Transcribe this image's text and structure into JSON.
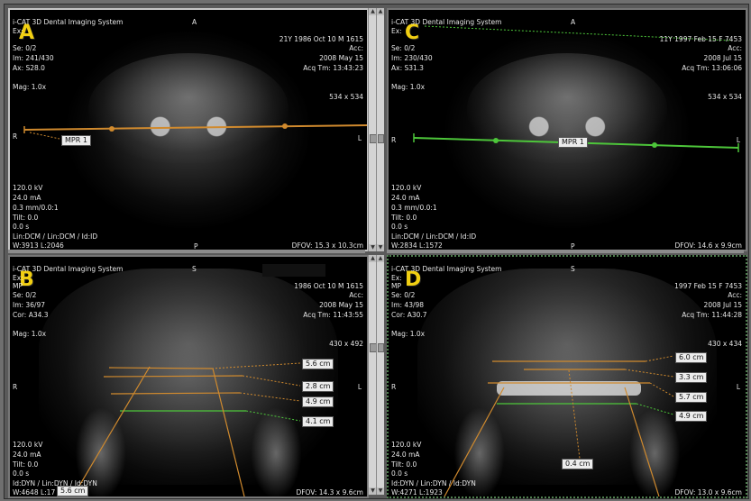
{
  "colors": {
    "orange": "#d08a2e",
    "green": "#4dc63a",
    "label_yellow": "#f1cf12"
  },
  "panels": {
    "A": {
      "letter": "A",
      "title": "i-CAT 3D Dental Imaging System",
      "orient_top": "A",
      "orient_bottom": "P",
      "orient_left": "R",
      "orient_right": "L",
      "ex": "Ex:",
      "se": "Se: 0/2",
      "im": "Im: 241/430",
      "ax": "Ax: S28.0",
      "mag": "Mag: 1.0x",
      "patient": "21Y 1986 Oct 10 M 1615",
      "acc": "Acc:",
      "date": "2008 May 15",
      "acq": "Acq Tm: 13:43:23",
      "matrix": "534 x 534",
      "kv": "120.0 kV",
      "ma": "24.0 mA",
      "mm": "0.3 mm/0.0:1",
      "tilt": "Tilt: 0.0",
      "time": "0.0 s",
      "lin": "Lin:DCM / Lin:DCM / Id:ID",
      "wl": "W:3913 L:2046",
      "dfov": "DFOV: 15.3 x 10.3cm",
      "mpr_label": "MPR 1"
    },
    "B": {
      "letter": "B",
      "title": "i-CAT 3D Dental Imaging System",
      "orient_top": "S",
      "orient_left": "R",
      "orient_right": "L",
      "ex": "Ex:",
      "mp": "MP",
      "se": "Se: 0/2",
      "im": "Im: 36/97",
      "cor": "Cor: A34.3",
      "mag": "Mag: 1.0x",
      "patient": "1986 Oct 10 M 1615",
      "acc": "Acc:",
      "date": "2008 May 15",
      "acq": "Acq Tm: 11:43:55",
      "matrix": "430 x 492",
      "kv": "120.0 kV",
      "ma": "24.0 mA",
      "tilt": "Tilt: 0.0",
      "time": "0.0 s",
      "lin": "Id:DYN / Lin:DYN / Id:DYN",
      "wl": "W:4648 L:17",
      "dfov": "DFOV: 14.3 x 9.6cm",
      "measures": [
        "5.6 cm",
        "2.8 cm",
        "4.9 cm",
        "4.1 cm",
        "5.6 cm"
      ]
    },
    "C": {
      "letter": "C",
      "title": "i-CAT 3D Dental Imaging System",
      "orient_top": "A",
      "orient_bottom": "P",
      "orient_left": "R",
      "orient_right": "L",
      "ex": "Ex:",
      "se": "Se: 0/2",
      "im": "Im: 230/430",
      "ax": "Ax: S31.3",
      "mag": "Mag: 1.0x",
      "patient": "11Y 1997 Feb 15 F 7453",
      "acc": "Acc:",
      "date": "2008 Jul 15",
      "acq": "Acq Tm: 13:06:06",
      "matrix": "534 x 534",
      "kv": "120.0 kV",
      "ma": "24.0 mA",
      "mm": "0.3 mm/0.0:1",
      "tilt": "Tilt: 0.0",
      "time": "0.0 s",
      "lin": "Lin:DCM / Lin:DCM / Id:ID",
      "wl": "W:2834 L:1572",
      "dfov": "DFOV: 14.6 x 9.9cm",
      "mpr_label": "MPR 1"
    },
    "D": {
      "letter": "D",
      "title": "i-CAT 3D Dental Imaging System",
      "orient_top": "S",
      "orient_left": "R",
      "orient_right": "L",
      "ex": "Ex:",
      "mp": "MP",
      "se": "Se: 0/2",
      "im": "Im: 43/98",
      "cor": "Cor: A30.7",
      "mag": "Mag: 1.0x",
      "patient": "1997 Feb 15 F 7453",
      "acc": "Acc:",
      "date": "2008 Jul 15",
      "acq": "Acq Tm: 11:44:28",
      "matrix": "430 x 434",
      "kv": "120.0 kV",
      "ma": "24.0 mA",
      "tilt": "Tilt: 0.0",
      "time": "0.0 s",
      "lin": "Id:DYN / Lin:DYN / Id:DYN",
      "wl": "W:4271 L:1923",
      "dfov": "DFOV: 13.0 x 9.6cm",
      "measures": [
        "6.0 cm",
        "3.3 cm",
        "5.7 cm",
        "4.9 cm",
        "0.4 cm"
      ]
    }
  }
}
